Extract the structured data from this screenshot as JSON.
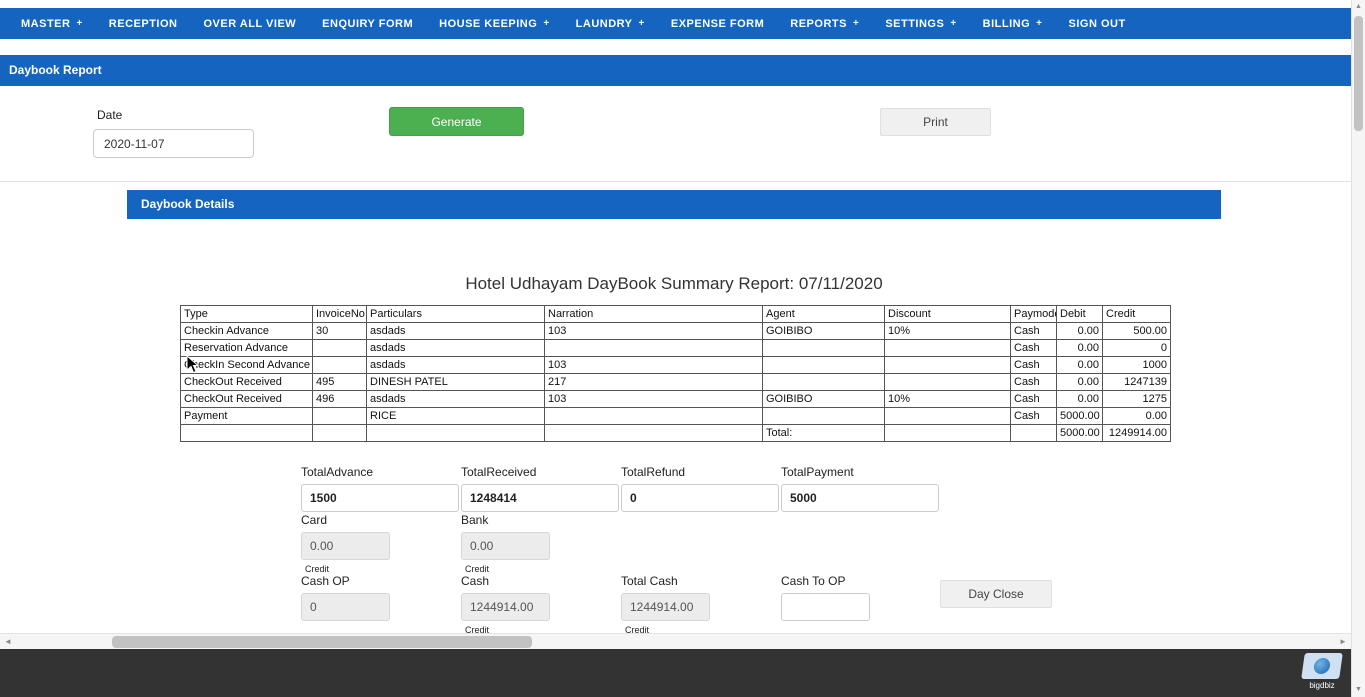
{
  "colors": {
    "primary_blue": "#1565c0",
    "success_green": "#4caf50"
  },
  "icons": {
    "plus": "+",
    "scroll_up": "▲",
    "scroll_down": "▼",
    "scroll_left": "◄",
    "scroll_right": "►"
  },
  "nav": {
    "items": [
      {
        "label": "MASTER",
        "has_dropdown": true
      },
      {
        "label": "RECEPTION",
        "has_dropdown": false
      },
      {
        "label": "OVER ALL VIEW",
        "has_dropdown": false
      },
      {
        "label": "ENQUIRY FORM",
        "has_dropdown": false
      },
      {
        "label": "HOUSE KEEPING",
        "has_dropdown": true
      },
      {
        "label": "LAUNDRY",
        "has_dropdown": true
      },
      {
        "label": "EXPENSE FORM",
        "has_dropdown": false
      },
      {
        "label": "REPORTS",
        "has_dropdown": true
      },
      {
        "label": "SETTINGS",
        "has_dropdown": true
      },
      {
        "label": "BILLING",
        "has_dropdown": true
      },
      {
        "label": "SIGN OUT",
        "has_dropdown": false
      }
    ]
  },
  "page": {
    "title": "Daybook Report",
    "date_label": "Date",
    "date_value": "2020-11-07",
    "generate_label": "Generate",
    "print_label": "Print"
  },
  "details": {
    "header": "Daybook Details",
    "report_title": "Hotel Udhayam DayBook Summary Report: 07/11/2020"
  },
  "table": {
    "columns": [
      "Type",
      "InvoiceNo",
      "Particulars",
      "Narration",
      "Agent",
      "Discount",
      "Paymode",
      "Debit",
      "Credit"
    ],
    "rows": [
      [
        "Checkin Advance",
        "30",
        "asdads",
        "103",
        "GOIBIBO",
        "10%",
        "Cash",
        "0.00",
        "500.00"
      ],
      [
        "Reservation Advance",
        "",
        "asdads",
        "",
        "",
        "",
        "Cash",
        "0.00",
        "0"
      ],
      [
        "CheckIn Second Advance",
        "",
        "asdads",
        "103",
        "",
        "",
        "Cash",
        "0.00",
        "1000"
      ],
      [
        "CheckOut Received",
        "495",
        "DINESH PATEL",
        "217",
        "",
        "",
        "Cash",
        "0.00",
        "1247139"
      ],
      [
        "CheckOut Received",
        "496",
        "asdads",
        "103",
        "GOIBIBO",
        "10%",
        "Cash",
        "0.00",
        "1275"
      ],
      [
        "Payment",
        "",
        "RICE",
        "",
        "",
        "",
        "Cash",
        "5000.00",
        "0.00"
      ],
      [
        "",
        "",
        "",
        "",
        "Total:",
        "",
        "",
        "5000.00",
        "1249914.00"
      ]
    ]
  },
  "summary": {
    "totals_row": [
      {
        "label": "TotalAdvance",
        "value": "1500"
      },
      {
        "label": "TotalReceived",
        "value": "1248414"
      },
      {
        "label": "TotalRefund",
        "value": "0"
      },
      {
        "label": "TotalPayment",
        "value": "5000"
      }
    ],
    "card": {
      "label": "Card",
      "value": "0.00",
      "caption": "Credit"
    },
    "bank": {
      "label": "Bank",
      "value": "0.00",
      "caption": "Credit"
    },
    "cash_op": {
      "label": "Cash OP",
      "value": "0"
    },
    "cash": {
      "label": "Cash",
      "value": "1244914.00",
      "caption": "Credit"
    },
    "total_cash": {
      "label": "Total Cash",
      "value": "1244914.00",
      "caption": "Credit"
    },
    "cash_to_op": {
      "label": "Cash To OP",
      "value": ""
    },
    "day_close_label": "Day Close"
  },
  "footer": {
    "brand": "bigdbiz"
  }
}
